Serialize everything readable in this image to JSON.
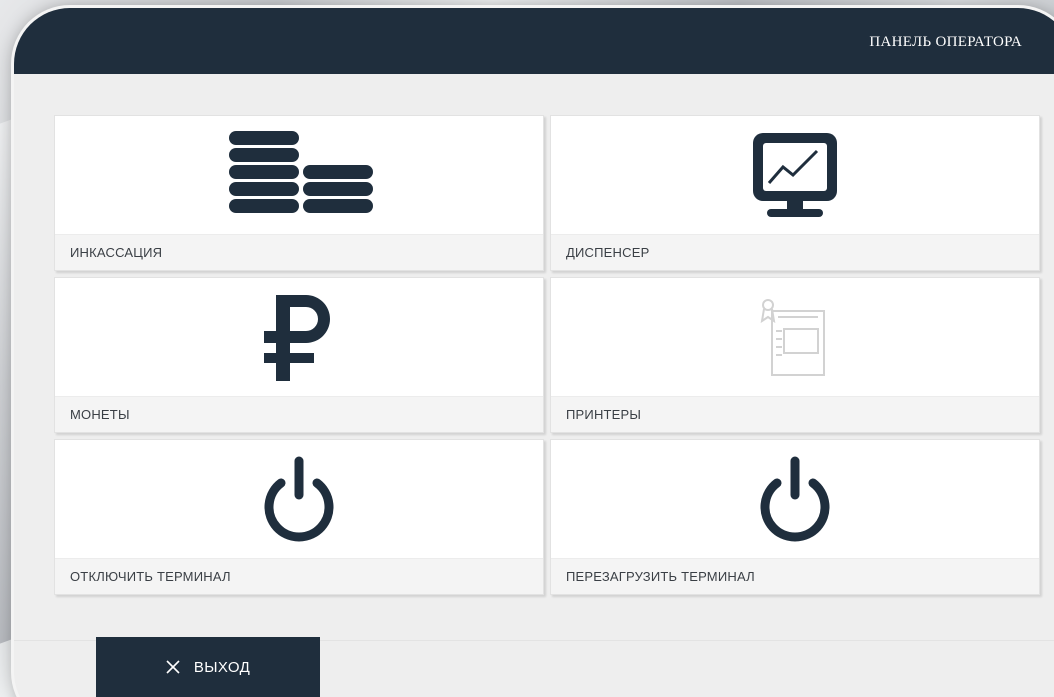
{
  "header": {
    "title": "ПАНЕЛЬ ОПЕРАТОРА"
  },
  "tiles": [
    {
      "label": "ИНКАССАЦИЯ",
      "icon": "coins-icon"
    },
    {
      "label": "ДИСПЕНСЕР",
      "icon": "monitor-chart-icon"
    },
    {
      "label": "МОНЕТЫ",
      "icon": "ruble-icon"
    },
    {
      "label": "ПРИНТЕРЫ",
      "icon": "printer-icon",
      "disabled": true
    },
    {
      "label": "ОТКЛЮЧИТЬ ТЕРМИНАЛ",
      "icon": "power-icon"
    },
    {
      "label": "ПЕРЕЗАГРУЗИТЬ ТЕРМИНАЛ",
      "icon": "power-icon"
    }
  ],
  "footer": {
    "exit_label": "ВЫХОД",
    "exit_icon": "close-icon"
  },
  "colors": {
    "primary": "#1f2e3d",
    "background": "#eeeeee",
    "disabled_icon": "#d2d2d2"
  }
}
